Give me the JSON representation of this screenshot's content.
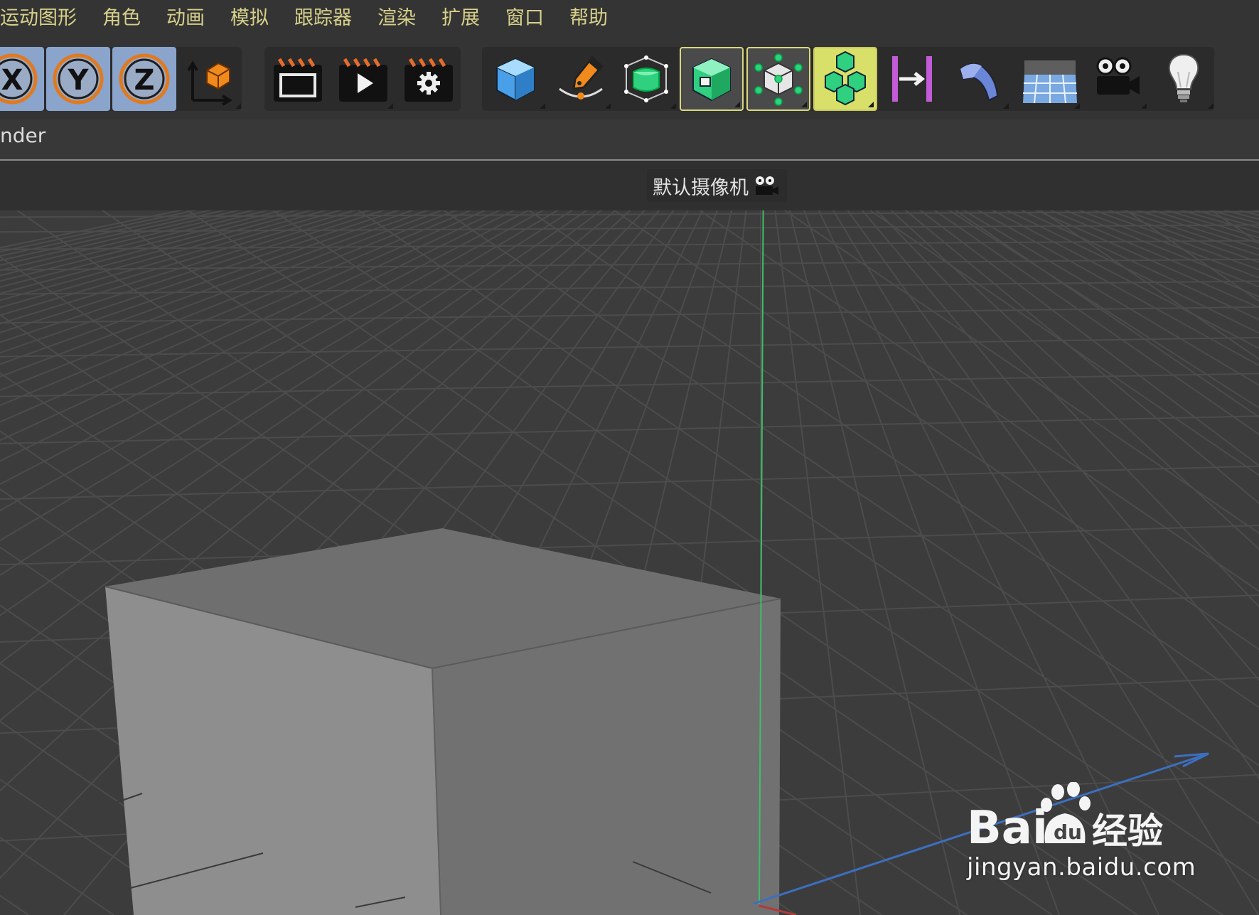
{
  "menu": {
    "items": [
      "运动图形",
      "角色",
      "动画",
      "模拟",
      "跟踪器",
      "渲染",
      "扩展",
      "窗口",
      "帮助"
    ]
  },
  "toolbar": {
    "buttons": [
      {
        "name": "x-axis-lock-button",
        "icon": "x-axis-icon",
        "label": "X"
      },
      {
        "name": "y-axis-lock-button",
        "icon": "y-axis-icon",
        "label": "Y"
      },
      {
        "name": "z-axis-lock-button",
        "icon": "z-axis-icon",
        "label": "Z"
      },
      {
        "name": "coordinate-system-button",
        "icon": "world-coordinates-icon"
      },
      {
        "name": "render-view-button",
        "icon": "clapper-render-view-icon"
      },
      {
        "name": "render-to-picture-viewer-button",
        "icon": "clapper-play-icon"
      },
      {
        "name": "render-settings-button",
        "icon": "clapper-gear-icon"
      },
      {
        "name": "cube-object-button",
        "icon": "cube-icon"
      },
      {
        "name": "pen-spline-button",
        "icon": "pen-icon"
      },
      {
        "name": "subdivision-surface-button",
        "icon": "subdivision-cube-icon"
      },
      {
        "name": "extrude-generator-button",
        "icon": "green-box-icon"
      },
      {
        "name": "mograph-array-button",
        "icon": "vertex-cube-icon"
      },
      {
        "name": "cloner-button",
        "icon": "cloner-cubes-icon"
      },
      {
        "name": "bend-deformer-button",
        "icon": "bend-deformer-icon"
      },
      {
        "name": "bend-object-button",
        "icon": "blue-bend-icon"
      },
      {
        "name": "floor-object-button",
        "icon": "floor-grid-icon"
      },
      {
        "name": "camera-object-button",
        "icon": "camera-icon"
      },
      {
        "name": "light-object-button",
        "icon": "light-bulb-icon"
      }
    ]
  },
  "panel": {
    "label": "nder"
  },
  "viewport": {
    "camera_label": "默认摄像机",
    "camera_icon": "camera-icon"
  },
  "watermark": {
    "brand": "Bai",
    "brand_suffix": "经验",
    "url": "jingyan.baidu.com"
  },
  "colors": {
    "menu_text": "#d7d08a",
    "axis_button": "#8aa4cc",
    "y_axis_line": "#3fbf6a",
    "z_axis_line": "#3d6fc0",
    "active_border": "#d8d880"
  }
}
